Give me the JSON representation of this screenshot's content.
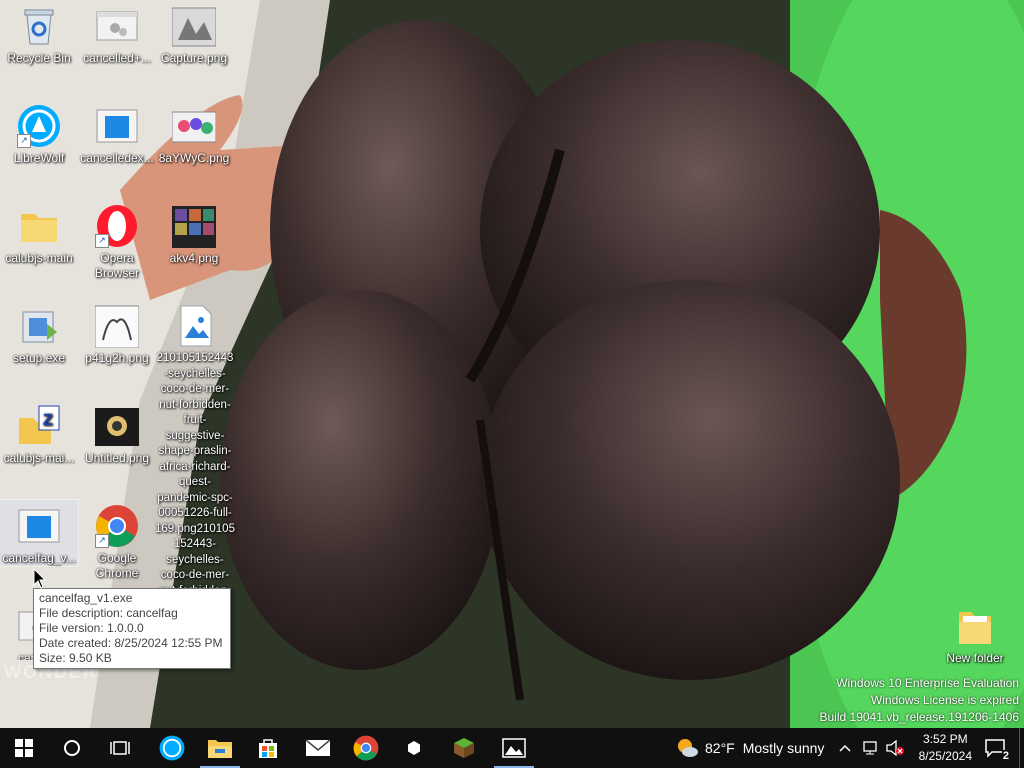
{
  "desktop": {
    "icons": [
      {
        "id": "recycle",
        "label": "Recycle Bin"
      },
      {
        "id": "cancelled",
        "label": "cancelled+..."
      },
      {
        "id": "capture",
        "label": "Capture.png"
      },
      {
        "id": "librewolf",
        "label": "LibreWolf"
      },
      {
        "id": "cancelledex",
        "label": "cancelledex..."
      },
      {
        "id": "8ayw",
        "label": "8aYWyC.png"
      },
      {
        "id": "calubjs",
        "label": "calubjs-main"
      },
      {
        "id": "opera",
        "label": "Opera Browser"
      },
      {
        "id": "akv4",
        "label": "akv4.png"
      },
      {
        "id": "setup",
        "label": "setup.exe"
      },
      {
        "id": "p4",
        "label": "p41g2h.png"
      },
      {
        "id": "longfile",
        "label": "210105152443-seychelles-coco-de-mer-nut-forbidden-fruit-suggestive-shape-praslin-africa-richard-quest-pandemic-spc-00051226-full-169.png210105152443-seychelles-coco-de-mer-nut-forbidden-fr..."
      },
      {
        "id": "calubjsmai",
        "label": "calubjs-mai..."
      },
      {
        "id": "untitled",
        "label": "Untitled.png"
      },
      {
        "id": "cancelfag",
        "label": "cancelfag_v..."
      },
      {
        "id": "chrome",
        "label": "Google Chrome"
      },
      {
        "id": "cance2",
        "label": "cance..."
      },
      {
        "id": "newfolder",
        "label": "New folder"
      }
    ],
    "watermark_text": "WONDER"
  },
  "tooltip": {
    "name": "cancelfag_v1.exe",
    "description": "File description: cancelfag",
    "version": "File version: 1.0.0.0",
    "created": "Date created: 8/25/2024 12:55 PM",
    "size": "Size: 9.50 KB"
  },
  "windows_watermark": {
    "line1": "Windows 10 Enterprise Evaluation",
    "line2": "Windows License is expired",
    "line3": "Build 19041.vb_release.191206-1406"
  },
  "taskbar": {
    "weather_temp": "82°F",
    "weather_text": "Mostly sunny",
    "time": "3:52 PM",
    "date": "8/25/2024",
    "notification_count": "2"
  },
  "colors": {
    "taskbar": "#101010",
    "accent": "#8ab4e6"
  }
}
